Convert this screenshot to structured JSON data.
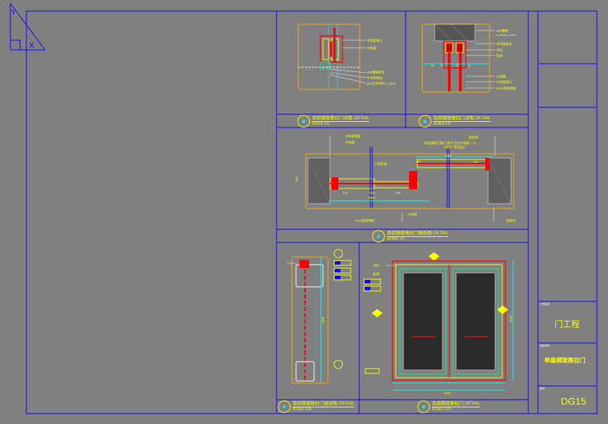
{
  "details": {
    "top_left": {
      "title": "双扇钢玻推拉门详图  DETAIL",
      "scale": "SCALE 1:5"
    },
    "top_right": {
      "title": "双扇钢玻推拉门详图  DETAIL",
      "scale": "SCALE 1:5"
    },
    "middle": {
      "title": "双扇钢玻推拉门横剖图  DETAIL",
      "scale": "SCALE 1:5"
    },
    "bottom_left": {
      "title": "双扇钢玻推拉门竖剖图 DETAIL",
      "scale": "SCALE 1:20"
    },
    "bottom_right": {
      "title": "双扇钢玻推拉门  DETAIL",
      "scale": "SCALE 1:20"
    }
  },
  "notes": {
    "tl_1": "木饰面收口",
    "tl_2": "木饰面",
    "tl_3": "10#槽钢吊架",
    "tl_4": "木龙骨基层",
    "tl_5": "φ12全牙吊杆 L=33.5",
    "tr_1": "10#槽钢",
    "tr_2": "L=53.5 L=150",
    "tr_3": "木饰面基层",
    "tr_4": "吊轨",
    "tr_5": "轨道",
    "tr_6": "木饰面",
    "tr_7": "木饰面收口",
    "tr_8": "5mm镀锌钢板",
    "m_1": "木饰面基层",
    "m_2": "木饰面",
    "m_3": "门扇玻璃",
    "m_4": "铝型材",
    "m_5": "成品钢玻门扇(门扇尺寸见大样图一十)",
    "m_6": "(详见厂家深化)",
    "m_7": "木饰面",
    "m_8": "5mm镀锌钢板",
    "m_9": "铝型材",
    "br_1": "吊轨",
    "br_2": "轨道"
  },
  "dims": {
    "m_120a": "120",
    "m_710": "710",
    "m_1000": "1000",
    "m_120b": "120",
    "m_1040": "1040",
    "m_120c": "120",
    "m_120d": "120",
    "m_400": "400",
    "bl_1640": "1640",
    "br_1100": "1100",
    "br_2040": "2040"
  },
  "title_block": {
    "project_label": "工程名称",
    "project": "门工程",
    "drawing_label": "图纸名称",
    "drawing": "单扇钢玻推拉门",
    "number_label": "图号",
    "number": "DG15"
  },
  "colors": {
    "background": "#808080",
    "frame": "#0000ff",
    "annotation": "#ffff00",
    "cut": "#ff0000",
    "dimension": "#00ffff",
    "glass_hatch": "#2a2a2a",
    "panel_outline": "#00ff7f"
  }
}
